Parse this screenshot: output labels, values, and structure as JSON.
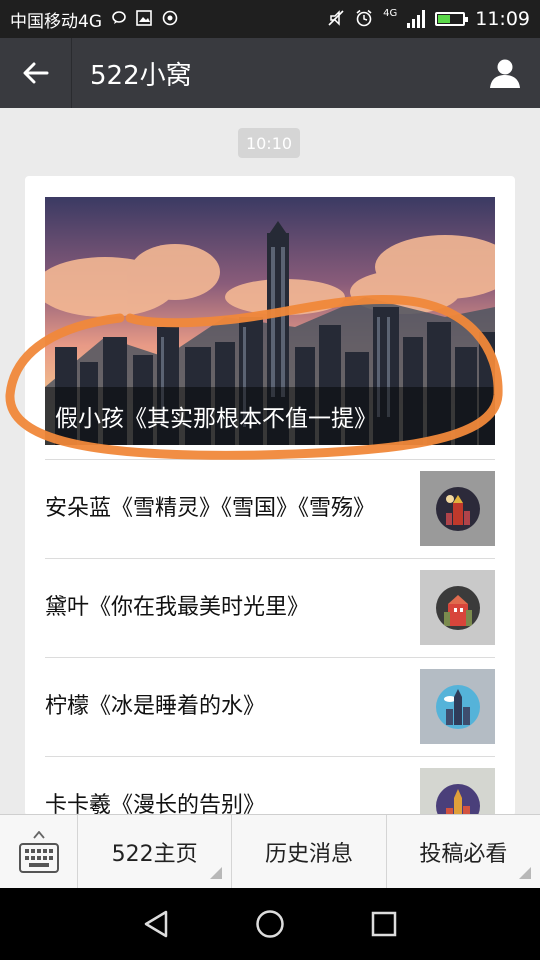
{
  "status_bar": {
    "carrier": "中国移动4G",
    "time": "11:09",
    "network": "4G",
    "battery_level": 0.5,
    "icons": [
      "chat-bubble-icon",
      "image-icon",
      "target-icon",
      "mute-icon",
      "alarm-icon",
      "signal-icon",
      "battery-icon"
    ]
  },
  "header": {
    "title": "522小窝",
    "back_icon": "back-arrow-icon",
    "profile_icon": "person-icon"
  },
  "chat": {
    "timestamp": "10:10",
    "article_card": {
      "cover_caption": "假小孩《其实那根本不值一提》",
      "items": [
        {
          "title": "安朵蓝《雪精灵》《雪国》《雪殇》"
        },
        {
          "title": "黛叶《你在我最美时光里》"
        },
        {
          "title": "柠檬《冰是睡着的水》"
        },
        {
          "title": "卡卡羲《漫长的告别》"
        }
      ]
    }
  },
  "menu": {
    "keyboard_icon": "keyboard-icon",
    "buttons": [
      {
        "label": "522主页"
      },
      {
        "label": "历史消息"
      },
      {
        "label": "投稿必看"
      }
    ]
  },
  "colors": {
    "status_bar_bg": "#1f1f1f",
    "title_bar_bg": "#393a3f",
    "chat_bg": "#ebebeb",
    "highlight_stroke": "#f0883a"
  }
}
